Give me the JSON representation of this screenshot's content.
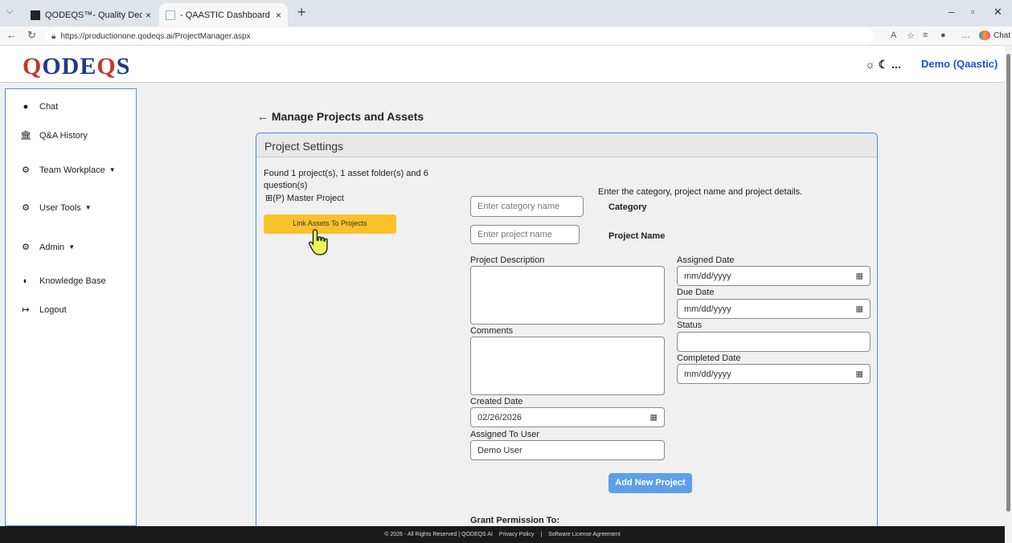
{
  "browser": {
    "tabs": [
      {
        "label": "QODEQS™- Quality Decisioning & ",
        "close": "×"
      },
      {
        "label": "- QAASTIC Dashboard",
        "close": "×"
      }
    ],
    "url": "https://productionone.qodeqs.ai/ProjectManager.aspx",
    "chat_label": "Chat"
  },
  "header": {
    "logo_part1": "Q",
    "logo_part2": "ODE",
    "logo_part3": "Q",
    "logo_part4": "S",
    "icons_text": "☼ ☾ ...",
    "user": "Demo (Qaastic)"
  },
  "sidebar": {
    "items": [
      {
        "label": "Chat",
        "icon": "chat-bubble-icon"
      },
      {
        "label": "Q&A History",
        "icon": "bank-icon"
      },
      {
        "label": "Team Workplace",
        "icon": "gears-icon"
      },
      {
        "label": "User Tools",
        "icon": "gears-icon"
      },
      {
        "label": "Admin",
        "icon": "gears-icon"
      },
      {
        "label": "Knowledge Base",
        "icon": "brain-icon"
      },
      {
        "label": "Logout",
        "icon": "logout-icon"
      }
    ]
  },
  "page": {
    "title": "← Manage Projects and Assets",
    "panel_title": "Project Settings",
    "found_line1": "Found 1 project(s), 1 asset folder(s) and 6",
    "found_line2": "question(s)",
    "tree_item": "⊞(P) Master Project",
    "link_button": "Link Assets To Projects",
    "instructions": "Enter the category, project name and project details.",
    "category_placeholder": "Enter category name",
    "category_label": "Category",
    "project_placeholder": "Enter project name",
    "project_label": "Project Name",
    "description_label": "Project Description",
    "comments_label": "Comments",
    "created_date_label": "Created Date",
    "created_date_value": "02/26/2026",
    "assigned_user_label": "Assigned To User",
    "assigned_user_value": "Demo User",
    "assigned_date_label": "Assigned Date",
    "assigned_date_value": "mm/dd/yyyy",
    "due_date_label": "Due Date",
    "due_date_value": "mm/dd/yyyy",
    "status_label": "Status",
    "status_value": "",
    "completed_date_label": "Completed Date",
    "completed_date_value": "mm/dd/yyyy",
    "add_button": "Add New Project",
    "grant_label": "Grant Permission To:"
  },
  "footer": {
    "copyright": "© 2026 - All Rights Reserved | QODEQS AI",
    "privacy": "Privacy Policy",
    "sep": "|",
    "license": "Software License Agreement"
  },
  "colors": {
    "accent_yellow": "#f8c22a",
    "accent_blue": "#5ea0e8",
    "logo_red": "#c0392b",
    "logo_blue": "#1f3a8a"
  }
}
